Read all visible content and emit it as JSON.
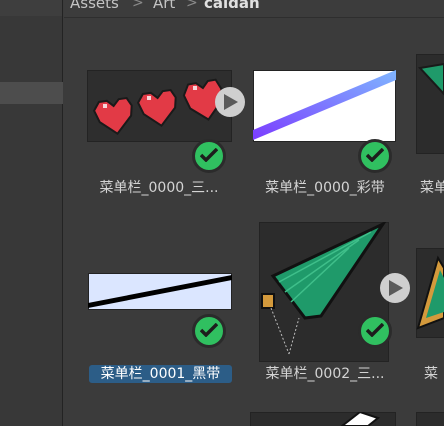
{
  "breadcrumb": {
    "items": [
      "Assets",
      "Art",
      "caidan"
    ],
    "separator": ">"
  },
  "assets": [
    {
      "label": "菜单栏_0000_三...",
      "status": "check-icon",
      "has_play": true
    },
    {
      "label": "菜单栏_0000_彩带",
      "status": "check-icon",
      "has_play": false
    },
    {
      "label": "菜单",
      "status": "check-icon",
      "has_play": false
    },
    {
      "label": "菜单栏_0001_黑带",
      "status": "check-icon",
      "has_play": false,
      "selected": true
    },
    {
      "label": "菜单栏_0002_三...",
      "status": "check-icon",
      "has_play": true
    },
    {
      "label": "菜",
      "status": "check-icon",
      "has_play": false
    }
  ],
  "colors": {
    "selection": "#2c5d87",
    "check": "#30c060",
    "heart": "#e23a46",
    "stripe_start": "#7b3cff",
    "stripe_end": "#7fb6ff",
    "flag_green": "#1f9a6a",
    "flag_orange": "#d49a3c"
  }
}
